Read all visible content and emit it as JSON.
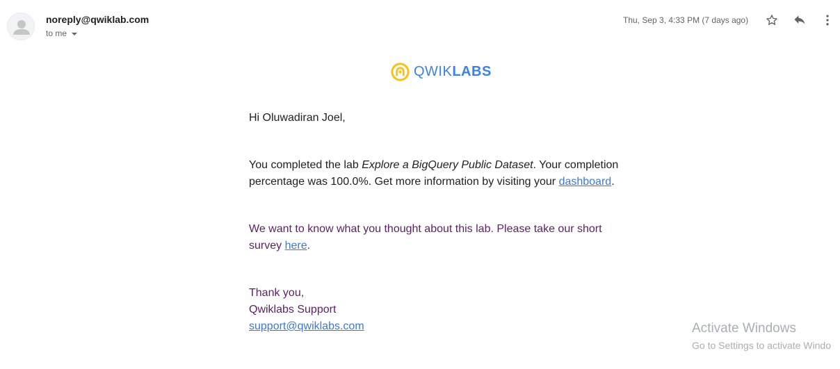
{
  "header": {
    "sender": "noreply@qwiklab.com",
    "recipient": "to me",
    "timestamp": "Thu, Sep 3, 4:33 PM (7 days ago)"
  },
  "icons": {
    "avatar": "person-icon",
    "star": "star-icon",
    "reply": "reply-icon",
    "more": "more-vert-icon",
    "caret": "caret-down-icon",
    "logo": "qwiklabs-logo-icon"
  },
  "logo": {
    "light": "QWIK",
    "bold": "LABS"
  },
  "email": {
    "greeting": "Hi Oluwadiran Joel,",
    "para1_prefix": "You completed the lab ",
    "para1_lab": "Explore a BigQuery Public Dataset",
    "para1_suffix": ". Your completion percentage was 100.0%. Get more information by visiting your ",
    "para1_link": "dashboard",
    "para1_end": ".",
    "para2_prefix": "We want to know what you thought about this lab. Please take our short survey ",
    "para2_link": "here",
    "para2_end": ".",
    "sign_thanks": "Thank you,",
    "sign_name": "Qwiklabs Support",
    "sign_email": "support@qwiklabs.com"
  },
  "watermark": {
    "title": "Activate Windows",
    "subtitle": "Go to Settings to activate Windo"
  },
  "colors": {
    "link": "#3b78d8",
    "purple_text": "#5b1f63",
    "logo_blue": "#3b82e4",
    "logo_yellow": "#f7c21a"
  }
}
